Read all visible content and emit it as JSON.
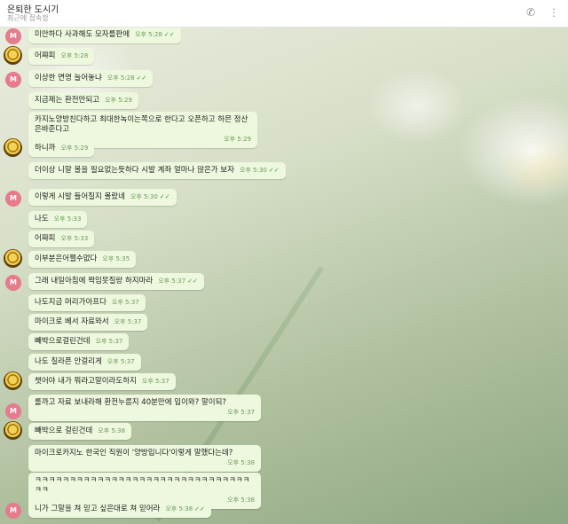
{
  "header": {
    "title": "은퇴한 도시기",
    "status": "최근에 접속함",
    "phone_icon": "phone-icon",
    "more_icon": "more-vertical-icon"
  },
  "avatar_letter": "M",
  "messages": [
    {
      "avatar": "M",
      "text": "미안하다 사과해도 모자를판에",
      "time": "오후 5:28",
      "read": "✓✓"
    },
    {
      "avatar": "gold",
      "text": "어쨔피",
      "time": "오후 5:28",
      "read": ""
    },
    {
      "avatar": "M",
      "text": "이상한 면명 늘어놓냐",
      "time": "오후 5:28",
      "read": "✓✓"
    },
    {
      "avatar": "",
      "text": "지금제는 환전만되고",
      "time": "오후 5:29",
      "read": ""
    },
    {
      "avatar": "",
      "text": "카지노양방친다하고 최대한녹이는쪽으로 한다고 오픈하고 하믄 정산 은바준다고",
      "time": "오후 5:29",
      "read": ""
    },
    {
      "avatar": "gold",
      "text": "하니까",
      "time": "오후 5:29",
      "read": ""
    },
    {
      "avatar": "",
      "text": "더이상 니말 볼을 필요없는듯하다 시발 계좌 얼마나 많은가 보자",
      "time": "오후 5:30",
      "read": "✓✓"
    },
    {
      "avatar": "M",
      "text": "이렇게 시발 들어질지 몰랐네",
      "time": "오후 5:30",
      "read": "✓✓"
    },
    {
      "avatar": "",
      "text": "나도",
      "time": "오후 5:33",
      "read": ""
    },
    {
      "avatar": "",
      "text": "어쨔피",
      "time": "오후 5:33",
      "read": ""
    },
    {
      "avatar": "gold",
      "text": "이부분은어쩔수없다",
      "time": "오후 5:35",
      "read": ""
    },
    {
      "avatar": "M",
      "text": "그래 내일아침에 짝임못질랑 하지마라",
      "time": "오후 5:37",
      "read": "✓✓"
    },
    {
      "avatar": "",
      "text": "나도지금 머리가아프다",
      "time": "오후 5:37",
      "read": ""
    },
    {
      "avatar": "",
      "text": "마이크로 베서 자료와서",
      "time": "오후 5:37",
      "read": ""
    },
    {
      "avatar": "",
      "text": "빼박으로걸린건데",
      "time": "오후 5:37",
      "read": ""
    },
    {
      "avatar": "",
      "text": "나도 칠라픈 안걸리게",
      "time": "오후 5:37",
      "read": ""
    },
    {
      "avatar": "gold",
      "text": "챗어야 내가 뭐라고말이라도하지",
      "time": "오후 5:37",
      "read": ""
    },
    {
      "avatar": "M",
      "text": "롤까고 자료 보내라해 환전누름지 40분만에 입이와? 말이되?",
      "time": "오후 5:37",
      "read": "✓✓"
    },
    {
      "avatar": "gold",
      "text": "빼박으로 걸린건데",
      "time": "오후 5:38",
      "read": ""
    },
    {
      "avatar": "",
      "text": "마이크로카지노 한국인 직원이 '양방입니다'이렇게 말했다는데?",
      "time": "오후 5:38",
      "read": "✓✓"
    },
    {
      "avatar": "",
      "text": "ㅋㅋㅋㅋㅋㅋㅋㅋㅋㅋㅋㅋㅋㅋㅋㅋㅋㅋㅋㅋㅋㅋㅋㅋㅋㅋㅋㅋㅋㅋㅋㅋㅋ",
      "time": "오후 5:38",
      "read": "✓✓"
    },
    {
      "avatar": "M",
      "text": "니가 그말을 쳐 믿고 싶은대로 쳐 믿어라",
      "time": "오후 5:38",
      "read": "✓✓"
    }
  ]
}
